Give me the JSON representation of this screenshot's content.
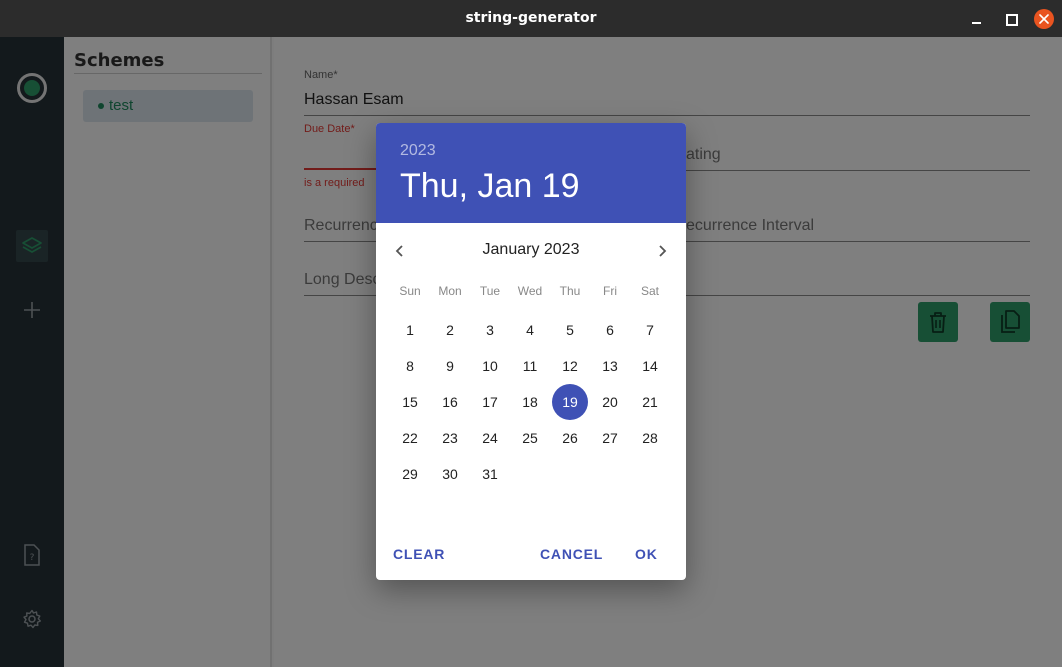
{
  "window": {
    "title": "string-generator"
  },
  "schemes": {
    "heading": "Schemes",
    "items": [
      {
        "label": "test"
      }
    ]
  },
  "form": {
    "name_label": "Name*",
    "name_value": "Hassan Esam",
    "due_date_label": "Due Date*",
    "due_date_error": "is a required",
    "rating_placeholder": "ating",
    "recurrence_placeholder": "Recurrenc",
    "recurrence_interval_placeholder": "ecurrence Interval",
    "long_desc_placeholder": "Long Desc"
  },
  "date_picker": {
    "year": "2023",
    "selected_date_label": "Thu, Jan 19",
    "month_label": "January 2023",
    "weekdays": [
      "Sun",
      "Mon",
      "Tue",
      "Wed",
      "Thu",
      "Fri",
      "Sat"
    ],
    "first_weekday_index": 0,
    "days_in_month": 31,
    "selected_day": 19,
    "clear_label": "CLEAR",
    "cancel_label": "CANCEL",
    "ok_label": "OK"
  },
  "colors": {
    "accent": "#3f51b5",
    "brand_green": "#2e9e6a",
    "error": "#e53935",
    "close_button": "#e95420"
  },
  "icons": {
    "rail": [
      "app-logo-icon",
      "layers-icon",
      "add-icon",
      "document-icon",
      "settings-icon"
    ],
    "actions": [
      "delete-icon",
      "copy-icon"
    ]
  }
}
